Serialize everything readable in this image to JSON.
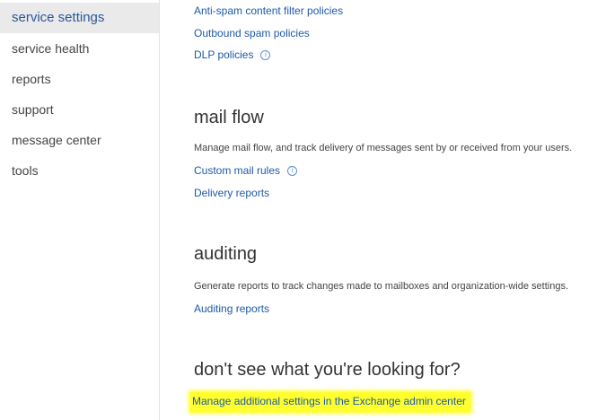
{
  "sidebar": {
    "items": [
      {
        "label": "service settings",
        "selected": true
      },
      {
        "label": "service health"
      },
      {
        "label": "reports"
      },
      {
        "label": "support"
      },
      {
        "label": "message center"
      },
      {
        "label": "tools"
      }
    ]
  },
  "spam": {
    "links": [
      "Anti-spam content filter policies",
      "Outbound spam policies",
      "DLP policies"
    ]
  },
  "mail_flow": {
    "title": "mail flow",
    "description": "Manage mail flow, and track delivery of messages sent by or received from your users.",
    "links": [
      "Custom mail rules",
      "Delivery reports"
    ]
  },
  "auditing": {
    "title": "auditing",
    "description": "Generate reports to track changes made to mailboxes and organization-wide settings.",
    "links": [
      "Auditing reports"
    ]
  },
  "more": {
    "title": "don't see what you're looking for?",
    "link": "Manage additional settings in the Exchange admin center"
  },
  "colors": {
    "accent": "#2b579a",
    "link": "#1e5aa8",
    "highlight": "#ffff2e"
  },
  "icons": {
    "info": "info-icon"
  }
}
